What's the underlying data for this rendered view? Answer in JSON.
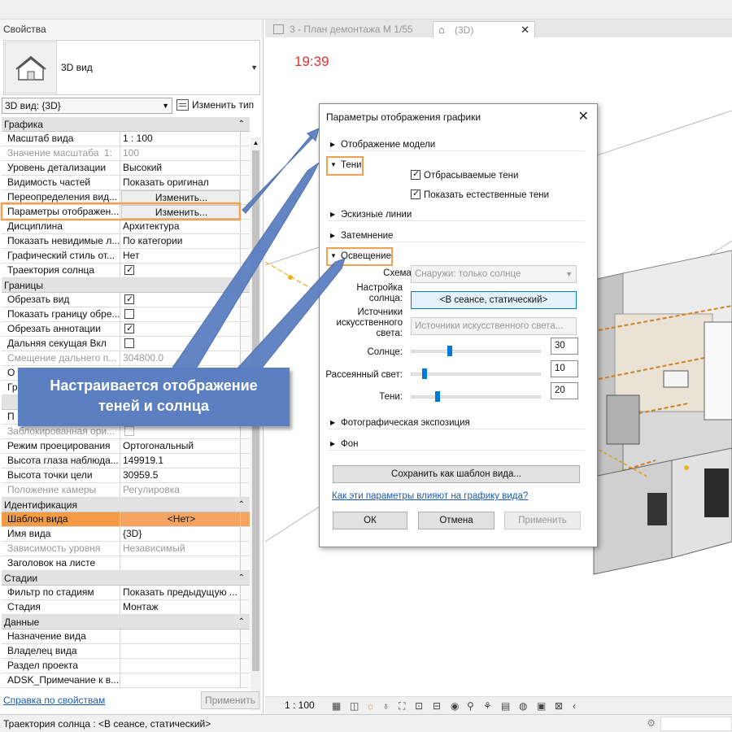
{
  "window": {
    "active_view_title": "(3D)",
    "clock": "19:39"
  },
  "tabs": [
    {
      "label": "3 - План демонтажа М 1/55"
    },
    {
      "label": "(3D)"
    }
  ],
  "properties": {
    "title": "Свойства",
    "type_name": "3D вид",
    "view_selector": "3D вид: {3D}",
    "edit_type": "Изменить тип",
    "help_link": "Справка по свойствам",
    "apply": "Применить",
    "groups": {
      "graphics": "Графика",
      "bounds": "Границы",
      "identity": "Идентификация",
      "phases": "Стадии",
      "data": "Данные"
    },
    "rows": {
      "scale": {
        "k": "Масштаб вида",
        "v": "1 : 100"
      },
      "scale_val": {
        "k": "Значение масштаба",
        "k2": "1:",
        "v": "100"
      },
      "detail": {
        "k": "Уровень детализации",
        "v": "Высокий"
      },
      "parts": {
        "k": "Видимость частей",
        "v": "Показать оригинал"
      },
      "overrides": {
        "k": "Переопределения вид...",
        "v": "Изменить..."
      },
      "display": {
        "k": "Параметры отображен...",
        "v": "Изменить..."
      },
      "discipline": {
        "k": "Дисциплина",
        "v": "Архитектура"
      },
      "hidden": {
        "k": "Показать невидимые л...",
        "v": "По категории"
      },
      "style": {
        "k": "Графический стиль от...",
        "v": "Нет"
      },
      "sunpath": {
        "k": "Траектория солнца"
      },
      "crop": {
        "k": "Обрезать вид"
      },
      "crop_border": {
        "k": "Показать границу обре..."
      },
      "crop_annot": {
        "k": "Обрезать аннотации"
      },
      "far_clip": {
        "k": "Дальняя секущая Вкл"
      },
      "far_offset": {
        "k": "Смещение дальнего п...",
        "v": "304800.0"
      },
      "partial1": {
        "k": "О"
      },
      "partial2": {
        "k": "Гр"
      },
      "partial3": {
        "k": "П"
      },
      "locked": {
        "k": "Заблокированная ори..."
      },
      "projection": {
        "k": "Режим проецирования",
        "v": "Ортогональный"
      },
      "eye": {
        "k": "Высота глаза наблюда...",
        "v": "149919.1"
      },
      "target": {
        "k": "Высота точки цели",
        "v": "30959.5"
      },
      "camera": {
        "k": "Положение камеры",
        "v": "Регулировка"
      },
      "template": {
        "k": "Шаблон вида",
        "v": "<Нет>"
      },
      "view_name": {
        "k": "Имя вида",
        "v": "{3D}"
      },
      "dependency": {
        "k": "Зависимость уровня",
        "v": "Независимый"
      },
      "sheet_title": {
        "k": "Заголовок на листе",
        "v": ""
      },
      "phase_filter": {
        "k": "Фильтр по стадиям",
        "v": "Показать предыдущую ..."
      },
      "phase": {
        "k": "Стадия",
        "v": "Монтаж"
      },
      "purpose": {
        "k": "Назначение вида"
      },
      "owner": {
        "k": "Владелец вида"
      },
      "section": {
        "k": "Раздел проекта"
      },
      "note": {
        "k": "ADSK_Примечание к в..."
      }
    }
  },
  "dialog": {
    "title": "Параметры отображения графики",
    "sections": {
      "model": "Отображение модели",
      "shadows": "Тени",
      "sketch": "Эскизные линии",
      "shading": "Затемнение",
      "lighting": "Освещение",
      "photo": "Фотографическая экспозиция",
      "background": "Фон"
    },
    "cast_shadows": "Отбрасываемые тени",
    "ambient_shadows": "Показать естественные тени",
    "scheme_label": "Схема:",
    "scheme_value": "Снаружи: только солнце",
    "sun_setting_label": "Настройка солнца:",
    "sun_setting_value": "<В сеансе, статический>",
    "artificial_label": "Источники искусственного света:",
    "artificial_button": "Источники искусственного света...",
    "sun_label": "Солнце:",
    "sun_value": "30",
    "ambient_label": "Рассеянный свет:",
    "ambient_value": "10",
    "shadows_label": "Тени:",
    "shadows_value": "20",
    "save_template": "Сохранить как шаблон вида...",
    "help_link": "Как эти параметры влияют на графику вида?",
    "ok": "ОК",
    "cancel": "Отмена",
    "apply": "Применить"
  },
  "callout": {
    "line1": "Настраивается отображение",
    "line2": "теней и солнца",
    "color": "#5b7fc0"
  },
  "view_bar": {
    "scale": "1 : 100"
  },
  "status_bar": {
    "text": "Траектория солнца : <В сеансе, статический>"
  },
  "colors": {
    "highlight": "#f0a050",
    "accent": "#0078d7",
    "clock": "#e03030"
  }
}
